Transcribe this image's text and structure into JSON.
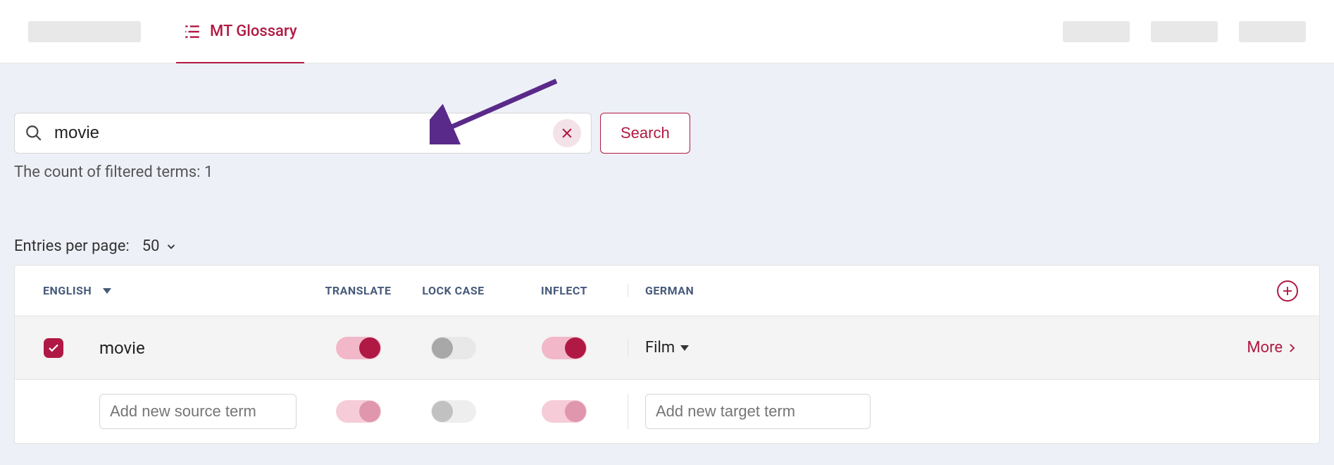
{
  "tabs": {
    "active_label": "MT Glossary"
  },
  "search": {
    "value": "movie",
    "button_label": "Search"
  },
  "filter_count_text": "The count of filtered terms: 1",
  "per_page": {
    "label": "Entries per page:",
    "value": "50"
  },
  "table": {
    "headers": {
      "source_lang": "ENGLISH",
      "translate": "TRANSLATE",
      "lock_case": "LOCK CASE",
      "inflect": "INFLECT",
      "target_lang": "GERMAN"
    },
    "rows": [
      {
        "checked": true,
        "source_term": "movie",
        "translate": true,
        "lock_case": false,
        "inflect": true,
        "target_term": "Film",
        "more_label": "More"
      }
    ],
    "add_row": {
      "source_placeholder": "Add new source term",
      "target_placeholder": "Add new target term",
      "translate": true,
      "lock_case": false,
      "inflect": true
    }
  }
}
